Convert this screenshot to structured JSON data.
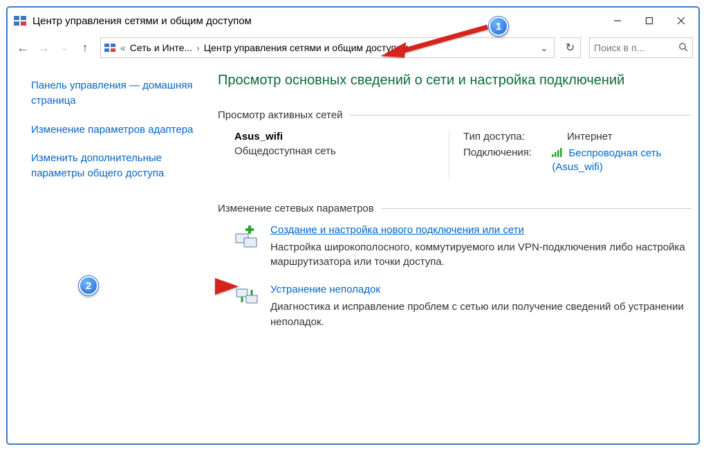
{
  "window": {
    "title": "Центр управления сетями и общим доступом"
  },
  "addressbar": {
    "crumb1": "Сеть и Инте...",
    "crumb2": "Центр управления сетями и общим доступом"
  },
  "search": {
    "placeholder": "Поиск в п..."
  },
  "sidebar": {
    "home": "Панель управления — домашняя страница",
    "adapter": "Изменение параметров адаптера",
    "sharing": "Изменить дополнительные параметры общего доступа"
  },
  "main": {
    "heading": "Просмотр основных сведений о сети и настройка подключений",
    "active_label": "Просмотр активных сетей",
    "network": {
      "name": "Asus_wifi",
      "type": "Общедоступная сеть",
      "access_k": "Тип доступа:",
      "access_v": "Интернет",
      "conn_k": "Подключения:",
      "conn_link": "Беспроводная сеть (Asus_wifi)"
    },
    "change_label": "Изменение сетевых параметров",
    "create": {
      "link": "Создание и настройка нового подключения или сети",
      "desc": "Настройка широкополосного, коммутируемого или VPN-подключения либо настройка маршрутизатора или точки доступа."
    },
    "trouble": {
      "link": "Устранение неполадок",
      "desc": "Диагностика и исправление проблем с сетью или получение сведений об устранении неполадок."
    }
  },
  "annotations": {
    "n1": "1",
    "n2": "2"
  }
}
